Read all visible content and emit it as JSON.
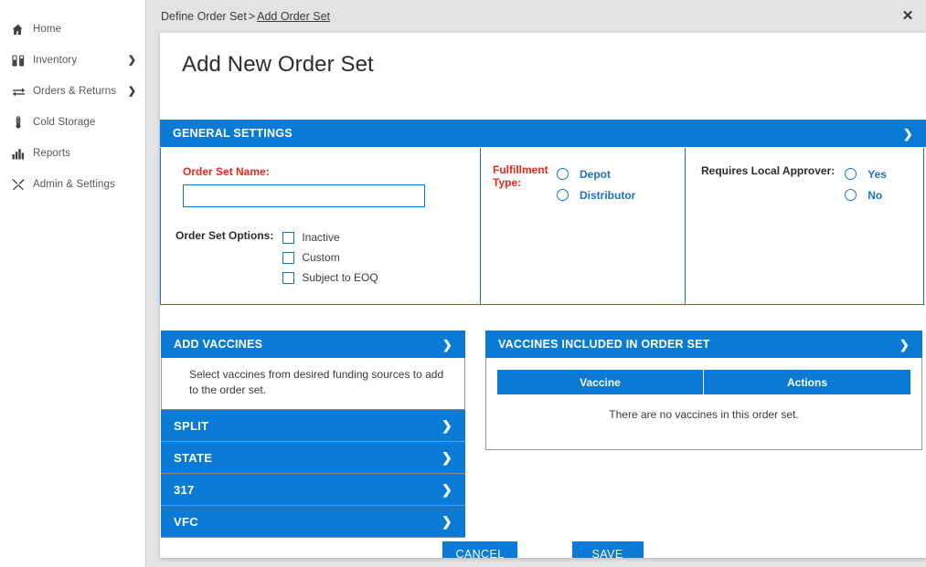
{
  "sidebar": {
    "items": [
      {
        "label": "Home",
        "icon": "home-icon",
        "has_arrow": false
      },
      {
        "label": "Inventory",
        "icon": "vials-icon",
        "has_arrow": true
      },
      {
        "label": "Orders & Returns",
        "icon": "transfer-icon",
        "has_arrow": true
      },
      {
        "label": "Cold Storage",
        "icon": "thermometer-icon",
        "has_arrow": false
      },
      {
        "label": "Reports",
        "icon": "bar-chart-icon",
        "has_arrow": false
      },
      {
        "label": "Admin & Settings",
        "icon": "tools-icon",
        "has_arrow": false
      }
    ]
  },
  "breadcrumb": {
    "parent": "Define Order Set",
    "separator": ">",
    "current": "Add Order Set"
  },
  "close_label": "✕",
  "page": {
    "title": "Add New Order Set"
  },
  "general_settings": {
    "header": "GENERAL SETTINGS",
    "caret": "❯",
    "order_set_name_label": "Order Set Name:",
    "order_set_name_value": "",
    "order_set_name_placeholder": "",
    "order_set_options_label": "Order Set Options:",
    "options": [
      {
        "label": "Inactive",
        "checked": false
      },
      {
        "label": "Custom",
        "checked": false
      },
      {
        "label": "Subject to EOQ",
        "checked": false
      }
    ],
    "fulfillment_type_label": "Fulfillment Type:",
    "fulfillment_options": [
      {
        "label": "Depot",
        "selected": false
      },
      {
        "label": "Distributor",
        "selected": false
      }
    ],
    "local_approver_label": "Requires Local Approver:",
    "local_approver_options": [
      {
        "label": "Yes",
        "selected": false
      },
      {
        "label": "No",
        "selected": false
      }
    ]
  },
  "add_vaccines": {
    "header": "ADD VACCINES",
    "caret": "❯",
    "description": "Select vaccines from desired funding sources to add to the order set.",
    "funding_sources": [
      {
        "label": "SPLIT",
        "caret": "❯"
      },
      {
        "label": "STATE",
        "caret": "❯"
      },
      {
        "label": "317",
        "caret": "❯"
      },
      {
        "label": "VFC",
        "caret": "❯"
      }
    ]
  },
  "included_vaccines": {
    "header": "VACCINES INCLUDED IN ORDER SET",
    "caret": "❯",
    "columns": [
      "Vaccine",
      "Actions"
    ],
    "rows": [],
    "empty_message": "There are no vaccines in this order set."
  },
  "footer": {
    "cancel_label": "CANCEL",
    "save_label": "SAVE"
  },
  "colors": {
    "primary_blue": "#0b7ad4",
    "required_red": "#e8291c",
    "page_background": "#e3e3e3",
    "panel_background": "#ffffff"
  }
}
